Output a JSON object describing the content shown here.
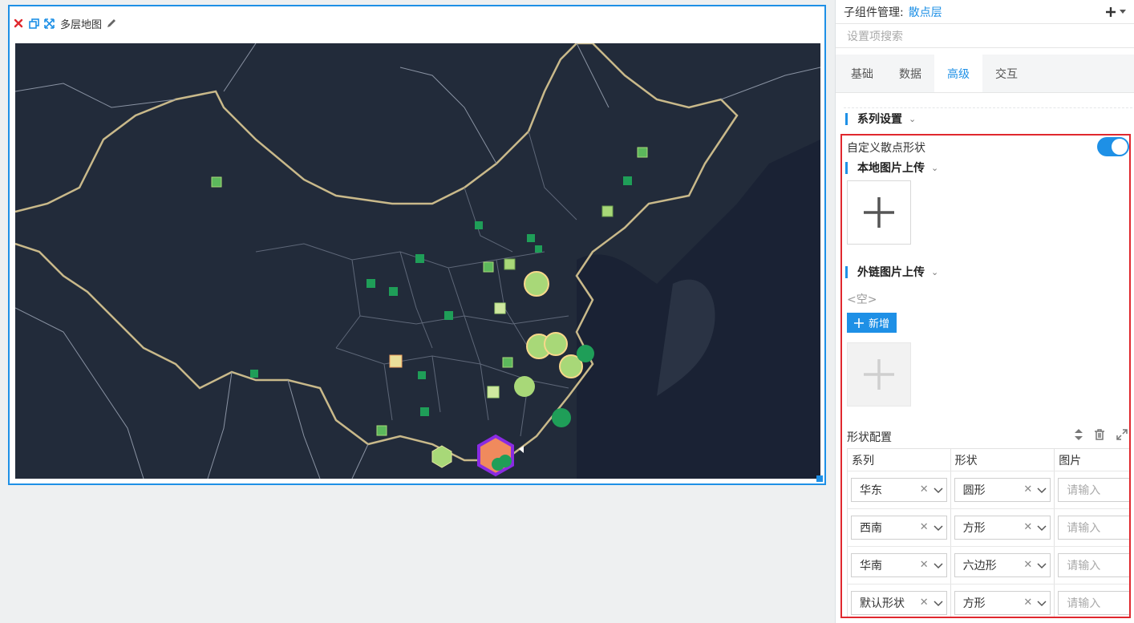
{
  "widget": {
    "title": "多层地图",
    "icons": [
      "close-icon",
      "copy-icon",
      "expand-icon",
      "edit-icon"
    ]
  },
  "panel": {
    "header_label": "子组件管理:",
    "header_sub": "散点层",
    "search_placeholder": "设置项搜索",
    "tabs": [
      {
        "label": "基础",
        "active": false
      },
      {
        "label": "数据",
        "active": false
      },
      {
        "label": "高级",
        "active": true
      },
      {
        "label": "交互",
        "active": false
      }
    ],
    "series_section": "系列设置",
    "custom_shape_label": "自定义散点形状",
    "custom_shape_enabled": true,
    "local_upload_title": "本地图片上传",
    "link_upload_title": "外链图片上传",
    "empty_text": "<空>",
    "add_button": "新增",
    "shape_config_label": "形状配置",
    "table": {
      "headers": [
        "系列",
        "形状",
        "图片"
      ],
      "rows": [
        {
          "series": "华东",
          "shape": "圆形",
          "image_placeholder": "请输入"
        },
        {
          "series": "西南",
          "shape": "方形",
          "image_placeholder": "请输入"
        },
        {
          "series": "华南",
          "shape": "六边形",
          "image_placeholder": "请输入"
        },
        {
          "series": "默认形状",
          "shape": "方形",
          "image_placeholder": "请输入"
        }
      ]
    }
  },
  "colors": {
    "accent": "#1e90e6",
    "map_bg": "#222b3a",
    "highlight_box": "#e0282e",
    "point_light": "#a8d878",
    "point_dark": "#1f9e58",
    "hex_orange": "#f08a5d",
    "hex_purple": "#8a2be2"
  }
}
